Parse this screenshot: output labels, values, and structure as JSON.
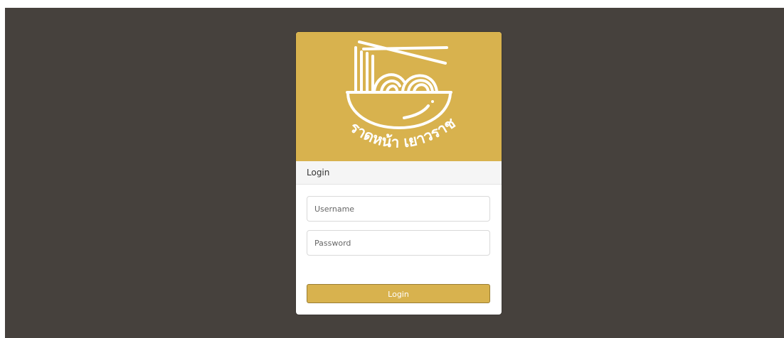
{
  "brand": {
    "logo_text": "ราดหน้า เยาวราช",
    "accent_color": "#d8b24e",
    "background_color": "#46413d"
  },
  "login_card": {
    "header_title": "Login",
    "username": {
      "placeholder": "Username",
      "value": ""
    },
    "password": {
      "placeholder": "Password",
      "value": ""
    },
    "submit_label": "Login"
  }
}
